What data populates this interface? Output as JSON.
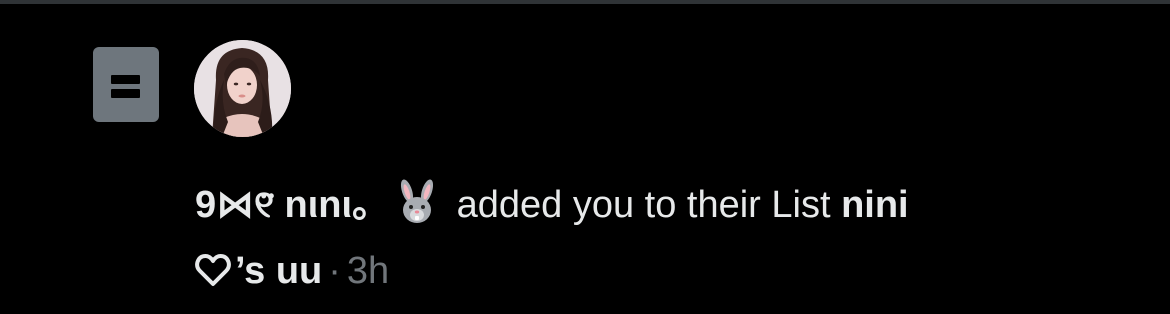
{
  "notification": {
    "actor_name": "9⋈୧̈ nιnι。",
    "actor_emoji_icon": "rabbit-face-icon",
    "action_text": " added you to their List ",
    "list_name_part1": "nini",
    "list_name_heart_icon": "white-heart-icon",
    "list_name_part2": "’s uu",
    "separator": "·",
    "timestamp": "3h"
  },
  "colors": {
    "background": "#000000",
    "divider": "#2f3336",
    "text_primary": "#e7e9ea",
    "text_secondary": "#71767b",
    "list_icon_bg": "#6e767d"
  }
}
